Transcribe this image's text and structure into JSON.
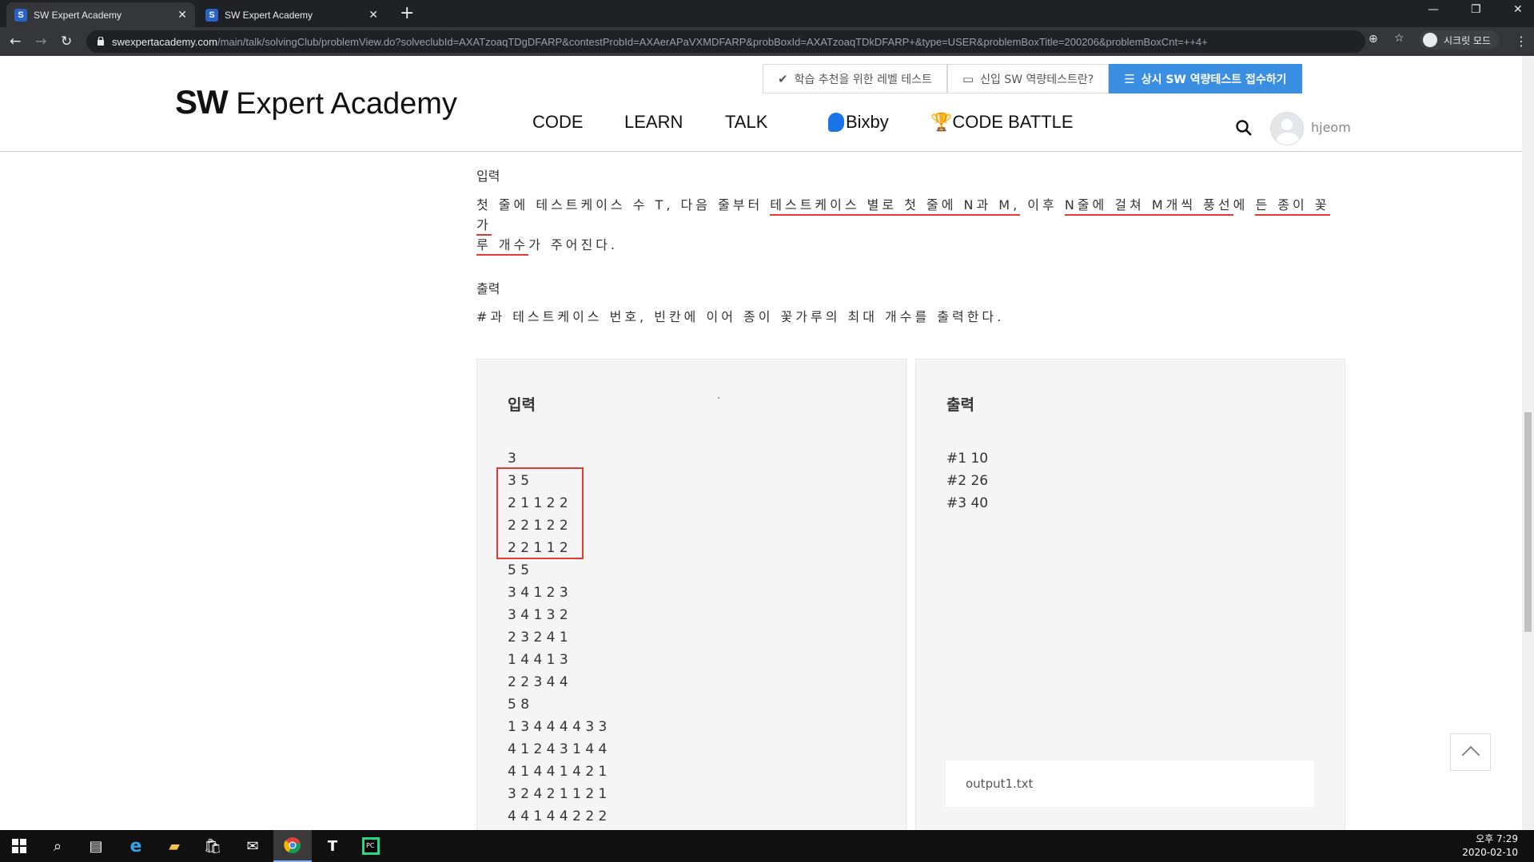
{
  "browser": {
    "tabs": [
      {
        "title": "SW Expert Academy",
        "active": true
      },
      {
        "title": "SW Expert Academy",
        "active": false
      }
    ],
    "url_host": "swexpertacademy.com",
    "url_path": "/main/talk/solvingClub/problemView.do?solveclubId=AXATzoaqTDgDFARP&contestProbId=AXAerAPaVXMDFARP&probBoxId=AXATzoaqTDkDFARP+&type=USER&problemBoxTitle=200206&problemBoxCnt=++4+",
    "incognito_label": "시크릿 모드"
  },
  "header": {
    "top_buttons": {
      "level_test": "학습 추천을 위한 레벨 테스트",
      "new_sw": "신입 SW 역량테스트란?",
      "apply": "상시 SW 역량테스트 접수하기"
    },
    "logo_sw": "SW",
    "logo_rest": " Expert Academy",
    "nav": {
      "code": "CODE",
      "learn": "LEARN",
      "talk": "TALK",
      "bixby": "Bixby",
      "battle": "CODE BATTLE"
    },
    "username": "hjeom"
  },
  "content": {
    "input_title": "입력",
    "input_desc": {
      "p1": "첫 줄에 테스트케이스 수 T, 다음 줄부터 ",
      "u1": "테스트케이스 별로 첫 줄에 N과 M,",
      "p2": " 이후 ",
      "u2": "N줄에 걸쳐 M개씩 풍선",
      "p3": "에 ",
      "u3a": "든 종이 꽃가",
      "u3b": "루 개수",
      "p4": "가 주어진다."
    },
    "output_title": "출력",
    "output_desc": "#과 테스트케이스 번호, 빈칸에 이어 종이 꽃가루의 최대 개수를 출력한다.",
    "input_box": {
      "title": "입력",
      "lines": [
        "3",
        "3 5",
        "2 1 1 2 2",
        "2 2 1 2 2",
        "2 2 1 1 2",
        "5 5",
        "3 4 1 2 3",
        "3 4 1 3 2",
        "2 3 2 4 1",
        "1 4 4 1 3",
        "2 2 3 4 4",
        "5 8",
        "1 3 4 4 4 4 3 3",
        "4 1 2 4 3 1 4 4",
        "4 1 4 4 1 4 2 1",
        "3 2 4 2 1 1 2 1",
        "4 4 1 4 4 2 2 2"
      ]
    },
    "output_box": {
      "title": "출력",
      "lines": [
        "#1 10",
        "#2 26",
        "#3 40"
      ],
      "file": "output1.txt"
    }
  },
  "taskbar": {
    "time": "오후 7:29",
    "date": "2020-02-10"
  }
}
